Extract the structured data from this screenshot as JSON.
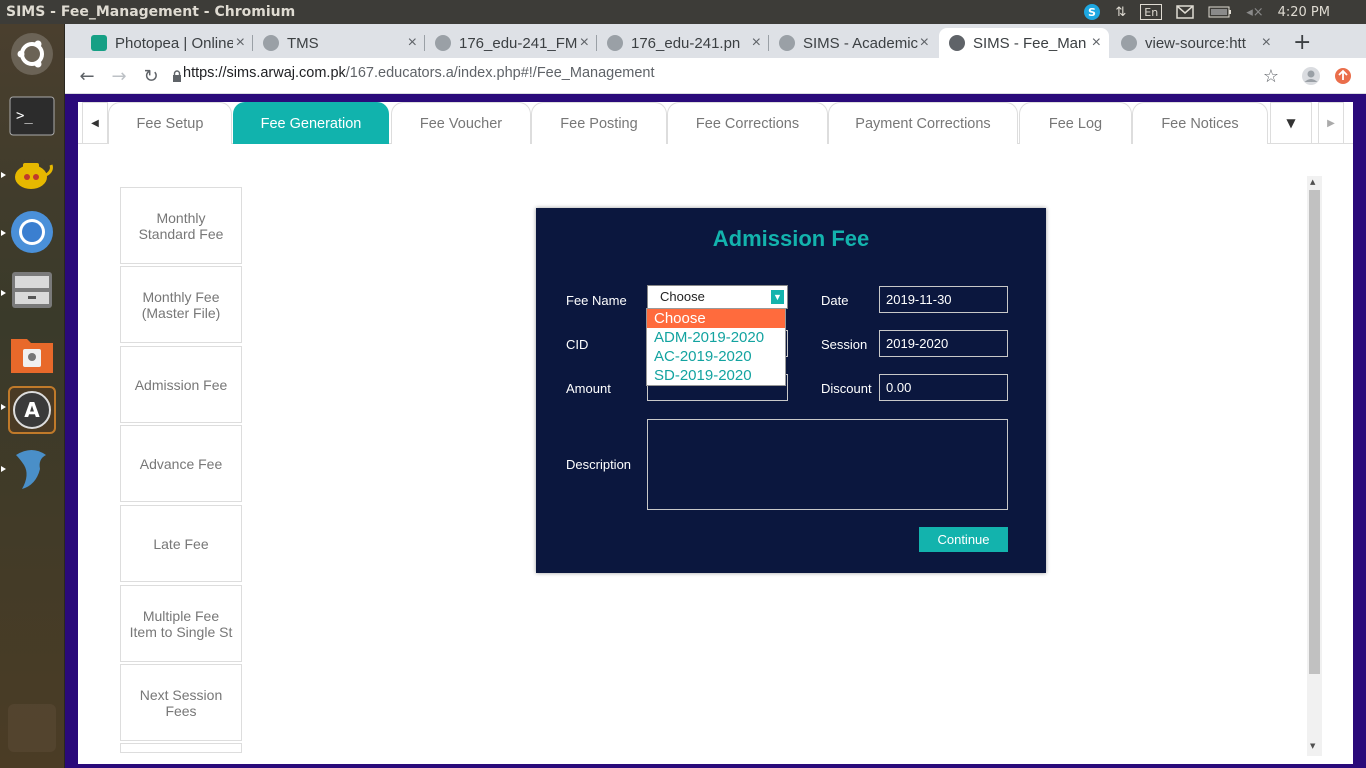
{
  "window": {
    "title": "SIMS - Fee_Management - Chromium"
  },
  "top_panel": {
    "language": "En",
    "clock": "4:20 PM"
  },
  "tabs": [
    {
      "title": "Photopea | Online",
      "active": false
    },
    {
      "title": "TMS",
      "active": false
    },
    {
      "title": "176_edu-241_FM",
      "active": false
    },
    {
      "title": "176_edu-241.pn",
      "active": false
    },
    {
      "title": "SIMS - Academic",
      "active": false
    },
    {
      "title": "SIMS - Fee_Man",
      "active": true
    },
    {
      "title": "view-source:htt",
      "active": false
    }
  ],
  "address_bar": {
    "host": "https://sims.arwaj.com.pk",
    "path": "/167.educators.a/index.php#!/Fee_Management"
  },
  "fee_tabs": [
    {
      "label": "Fee Setup"
    },
    {
      "label": "Fee Generation"
    },
    {
      "label": "Fee Voucher"
    },
    {
      "label": "Fee Posting"
    },
    {
      "label": "Fee Corrections"
    },
    {
      "label": "Payment Corrections"
    },
    {
      "label": "Fee Log"
    },
    {
      "label": "Fee Notices"
    }
  ],
  "side_menu": [
    {
      "label": "Monthly Standard Fee"
    },
    {
      "label": "Monthly Fee (Master File)"
    },
    {
      "label": "Admission Fee"
    },
    {
      "label": "Advance Fee"
    },
    {
      "label": "Late Fee"
    },
    {
      "label": "Multiple Fee Item to Single St"
    },
    {
      "label": "Next Session Fees"
    }
  ],
  "modal": {
    "title": "Admission Fee",
    "labels": {
      "fee_name": "Fee Name",
      "cid": "CID",
      "amount": "Amount",
      "description": "Description",
      "date": "Date",
      "session": "Session",
      "discount": "Discount"
    },
    "fee_name_selected": "Choose",
    "fee_name_options": [
      "Choose",
      "ADM-2019-2020",
      "AC-2019-2020",
      "SD-2019-2020"
    ],
    "date_value": "2019-11-30",
    "session_value": "2019-2020",
    "discount_value": "0.00",
    "continue_label": "Continue"
  },
  "colors": {
    "accent": "#13b3ad",
    "modal_bg": "#0b173e",
    "dropdown_selected": "#ff6b3d",
    "page_frame": "#2a0a7a"
  }
}
